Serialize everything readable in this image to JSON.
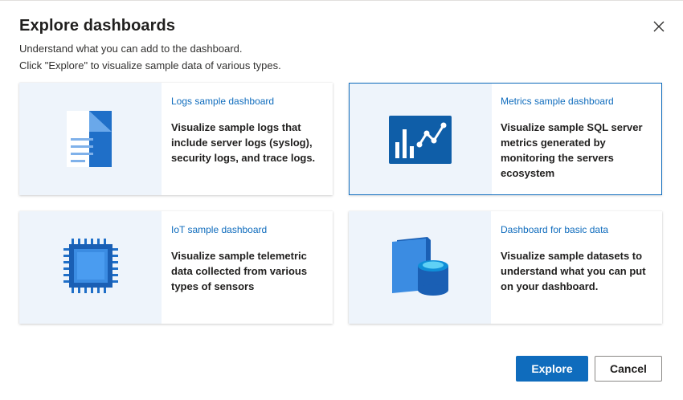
{
  "dialog": {
    "title": "Explore dashboards",
    "description_line1": "Understand what you can add to the dashboard.",
    "description_line2": "Click \"Explore\" to visualize sample data of various types."
  },
  "cards": [
    {
      "title": "Logs sample dashboard",
      "body": "Visualize sample logs that include server logs (syslog), security logs, and trace logs.",
      "icon": "document-icon",
      "selected": false
    },
    {
      "title": "Metrics sample dashboard",
      "body": "Visualize sample SQL server metrics generated by monitoring the servers ecosystem",
      "icon": "chart-icon",
      "selected": true
    },
    {
      "title": "IoT sample dashboard",
      "body": "Visualize sample telemetric data collected from various types of sensors",
      "icon": "chip-icon",
      "selected": false
    },
    {
      "title": "Dashboard for basic data",
      "body": "Visualize sample datasets to understand what you can put on your dashboard.",
      "icon": "database-icon",
      "selected": false
    }
  ],
  "buttons": {
    "explore": "Explore",
    "cancel": "Cancel"
  },
  "colors": {
    "accent": "#0f6cbd",
    "card_art_background": "#eef4fb"
  }
}
